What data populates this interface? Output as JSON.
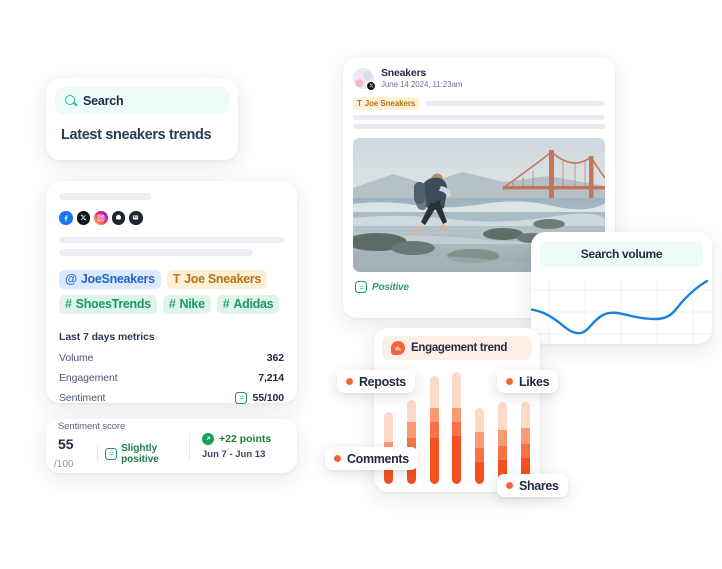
{
  "search_card": {
    "icon": "search-icon",
    "field_value": "Search",
    "field_placeholder": "Search",
    "latest_label": "Latest sneakers trends"
  },
  "profile_card": {
    "socials": [
      {
        "name": "facebook-icon",
        "color": "#1877f2"
      },
      {
        "name": "x-twitter-icon",
        "color": "#111418"
      },
      {
        "name": "instagram-icon",
        "color": "#ee2a7b"
      },
      {
        "name": "reddit-icon",
        "color": "#20262e"
      },
      {
        "name": "news-icon",
        "color": "#20262e"
      }
    ],
    "tags": [
      {
        "symbol": "@",
        "label": "JoeSneakers",
        "style": "blue"
      },
      {
        "symbol": "T",
        "label": "Joe Sneakers",
        "style": "amber"
      },
      {
        "symbol": "#",
        "label": "ShoesTrends",
        "style": "green"
      },
      {
        "symbol": "#",
        "label": "Nike",
        "style": "green"
      },
      {
        "symbol": "#",
        "label": "Adidas",
        "style": "green"
      }
    ],
    "metrics_title": "Last 7 days metrics",
    "metrics": [
      {
        "label": "Volume",
        "value": "362",
        "face": false
      },
      {
        "label": "Engagement",
        "value": "7,214",
        "face": false
      },
      {
        "label": "Sentiment",
        "value": "55/100",
        "face": true
      }
    ]
  },
  "sentiment_card": {
    "label": "Sentiment score",
    "score": "55",
    "denominator": "/100",
    "verdict": "Slightly positive",
    "points": "+22 points",
    "range": "Jun 7 - Jun 13"
  },
  "post_card": {
    "author": "Sneakers",
    "timestamp": "June 14 2024, 11:23am",
    "source_badge": "x-twitter-icon",
    "tag": {
      "symbol": "T",
      "label": "Joe Sneakers"
    },
    "photo_alt": "hiker-walking-on-beach-near-golden-gate-bridge",
    "sentiment": "Positive"
  },
  "volume_card": {
    "title": "Search volume"
  },
  "engagement_card": {
    "title": "Engagement trend",
    "icon": "chart-bubble-icon",
    "legend": [
      {
        "label": "Reposts",
        "color": "#f4643a"
      },
      {
        "label": "Likes",
        "color": "#f4643a"
      },
      {
        "label": "Comments",
        "color": "#f4643a"
      },
      {
        "label": "Shares",
        "color": "#f4643a"
      }
    ]
  },
  "chart_data": [
    {
      "type": "line",
      "title": "Search volume",
      "xlabel": "",
      "ylabel": "",
      "grid": true,
      "legend_position": "none",
      "line_color": "#1a7fe0",
      "x": [
        0,
        1,
        2,
        3,
        4,
        5,
        6,
        7,
        8,
        9,
        10
      ],
      "values": [
        44,
        38,
        22,
        14,
        26,
        42,
        40,
        36,
        35,
        55,
        80
      ],
      "ylim": [
        0,
        100
      ]
    },
    {
      "type": "bar",
      "title": "Engagement trend",
      "stacked": true,
      "xlabel": "",
      "ylabel": "",
      "grid": false,
      "legend_position": "floating",
      "categories": [
        "1",
        "2",
        "3",
        "4",
        "5",
        "6",
        "7"
      ],
      "series": [
        {
          "name": "Comments",
          "color": "#f4511e",
          "values": [
            18,
            30,
            46,
            48,
            22,
            24,
            26
          ]
        },
        {
          "name": "Shares",
          "color": "#f77347",
          "values": [
            10,
            16,
            16,
            14,
            14,
            14,
            14
          ]
        },
        {
          "name": "Reposts",
          "color": "#fa9a74",
          "values": [
            14,
            16,
            14,
            14,
            16,
            16,
            16
          ]
        },
        {
          "name": "Likes",
          "color": "#fdd9c8",
          "values": [
            30,
            22,
            38,
            42,
            24,
            28,
            26
          ]
        }
      ],
      "ylim": [
        0,
        120
      ]
    }
  ]
}
